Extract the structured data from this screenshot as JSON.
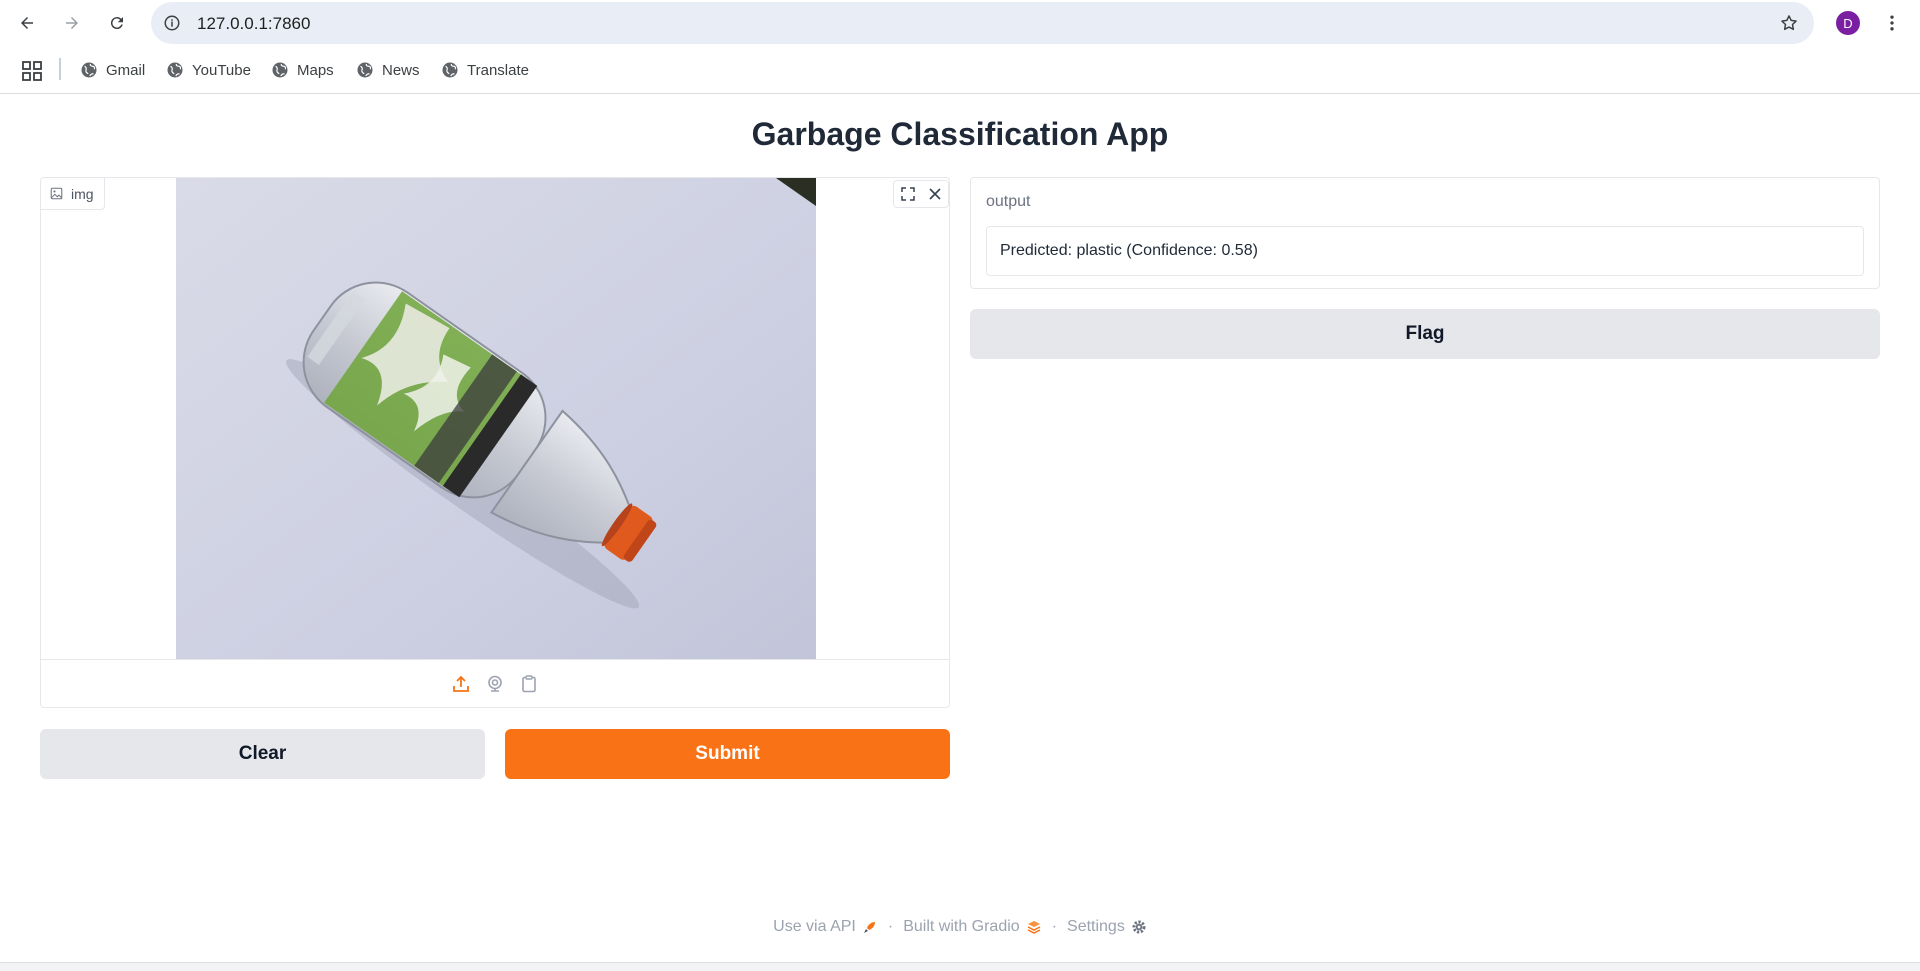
{
  "browser": {
    "url": "127.0.0.1:7860",
    "profile_initial": "D",
    "profile_color": "#7b1fa2",
    "bookmarks": [
      {
        "label": "Gmail",
        "icon": "globe-icon"
      },
      {
        "label": "YouTube",
        "icon": "globe-icon"
      },
      {
        "label": "Maps",
        "icon": "globe-icon"
      },
      {
        "label": "News",
        "icon": "globe-icon"
      },
      {
        "label": "Translate",
        "icon": "globe-icon"
      }
    ]
  },
  "app": {
    "title": "Garbage Classification App",
    "image_input": {
      "label": "img",
      "image_description_icon": "image-icon",
      "sources": [
        "upload-icon",
        "webcam-icon",
        "clipboard-icon"
      ]
    },
    "buttons": {
      "clear": "Clear",
      "submit": "Submit",
      "flag": "Flag"
    },
    "output": {
      "label": "output",
      "value": "Predicted: plastic (Confidence: 0.58)"
    },
    "footer": {
      "api": "Use via API",
      "built": "Built with Gradio",
      "settings": "Settings",
      "separator": "·"
    },
    "colors": {
      "accent": "#f97316",
      "secondary_button": "#e5e7eb"
    }
  }
}
